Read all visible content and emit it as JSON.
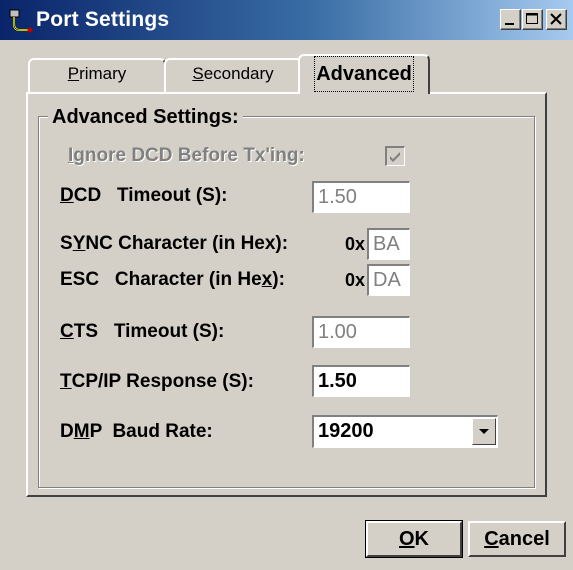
{
  "window": {
    "title": "Port Settings",
    "app_icon": "serial-port-icon",
    "controls": {
      "minimize": "minimize-icon",
      "maximize": "maximize-icon",
      "close": "close-icon"
    }
  },
  "tabs": [
    {
      "label_mnemonic": "P",
      "label_rest": "rimary",
      "active": false
    },
    {
      "label_mnemonic": "S",
      "label_rest": "econdary",
      "active": false
    },
    {
      "label": "Advanced",
      "active": true
    }
  ],
  "group": {
    "title": "Advanced Settings:"
  },
  "fields": {
    "ignore_dcd": {
      "mnemonic": "I",
      "rest": "gnore DCD Before Tx'ing:",
      "checked": true,
      "enabled": false
    },
    "dcd_timeout": {
      "mnemonic": "D",
      "rest": "CD   Timeout (S):",
      "value": "1.50",
      "enabled": false
    },
    "sync_char": {
      "prefix": "S",
      "mnemonic": "Y",
      "rest": "NC Character (in Hex):",
      "hex_prefix": "0x",
      "value": "BA",
      "enabled": false
    },
    "esc_char": {
      "prefix": "ESC   Character (in He",
      "mnemonic": "x",
      "rest": "):",
      "hex_prefix": "0x",
      "value": "DA",
      "enabled": false
    },
    "cts_timeout": {
      "mnemonic": "C",
      "rest": "TS   Timeout (S):",
      "value": "1.00",
      "enabled": false
    },
    "tcpip_response": {
      "mnemonic": "T",
      "rest": "CP/IP Response (S):",
      "value": "1.50",
      "enabled": true
    },
    "dmp_baud": {
      "prefix": "D",
      "mnemonic": "M",
      "rest": "P  Baud Rate:",
      "value": "19200",
      "enabled": true
    }
  },
  "buttons": {
    "ok": {
      "mnemonic": "O",
      "rest": "K"
    },
    "cancel": {
      "mnemonic": "C",
      "rest": "ancel"
    }
  }
}
